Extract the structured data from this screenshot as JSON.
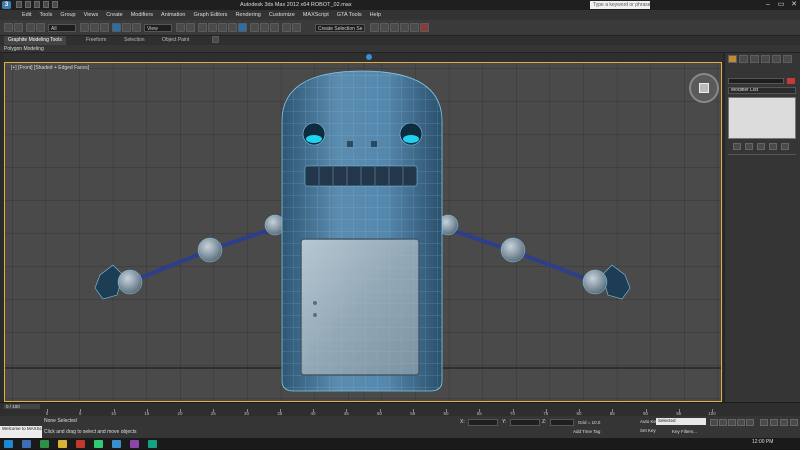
{
  "titlebar": {
    "app_button": "3",
    "title": "Autodesk 3ds Max 2012 x64    ROBOT_02.max",
    "help_search": "Type a keyword or phrase",
    "controls": [
      "–",
      "▭",
      "✕"
    ]
  },
  "menubar": {
    "items": [
      "Edit",
      "Tools",
      "Group",
      "Views",
      "Create",
      "Modifiers",
      "Animation",
      "Graph Editors",
      "Rendering",
      "Customize",
      "MAXScript",
      "GTA Tools",
      "Help"
    ]
  },
  "toolbar": {
    "selection_filter": "All",
    "selection_set": "View",
    "named_selection": "Create Selection Se"
  },
  "ribbon": {
    "tabs": [
      "Graphite Modeling Tools",
      "Freeform",
      "Selection",
      "Object Paint"
    ],
    "active_tab": "Graphite Modeling Tools",
    "panel_label": "Polygon Modeling"
  },
  "viewport": {
    "label": "[+] [Front] [Shaded + Edged Faces]"
  },
  "command_panel": {
    "modifier_list": "Modifier List"
  },
  "timeline": {
    "frame_counter": "0 / 100",
    "ticks": [
      "0",
      "5",
      "10",
      "15",
      "20",
      "25",
      "30",
      "35",
      "40",
      "45",
      "50",
      "55",
      "60",
      "65",
      "70",
      "75",
      "80",
      "85",
      "90",
      "95",
      "100"
    ]
  },
  "status": {
    "maxscript": "Welcome to MAXScript.",
    "selection": "None Selected",
    "prompt": "Click and drag to select and move objects",
    "x_label": "X:",
    "y_label": "Y:",
    "z_label": "Z:",
    "grid": "Grid = 10.0",
    "add_time_tag": "Add Time Tag",
    "auto_key": "Auto Key",
    "set_key": "Set Key",
    "selected": "Selected",
    "key_filters": "Key Filters..."
  },
  "taskbar": {
    "time": "12:00 PM"
  },
  "colors": {
    "accent_blue": "#3a8fd0",
    "viewport_bg": "#494949",
    "grid_line": "#2a2a2a",
    "robot_body": "#4d7b9c",
    "wireframe": "#7fc8e8",
    "eye_glow": "#1fd2ef",
    "viewport_border": "#e0b040"
  }
}
